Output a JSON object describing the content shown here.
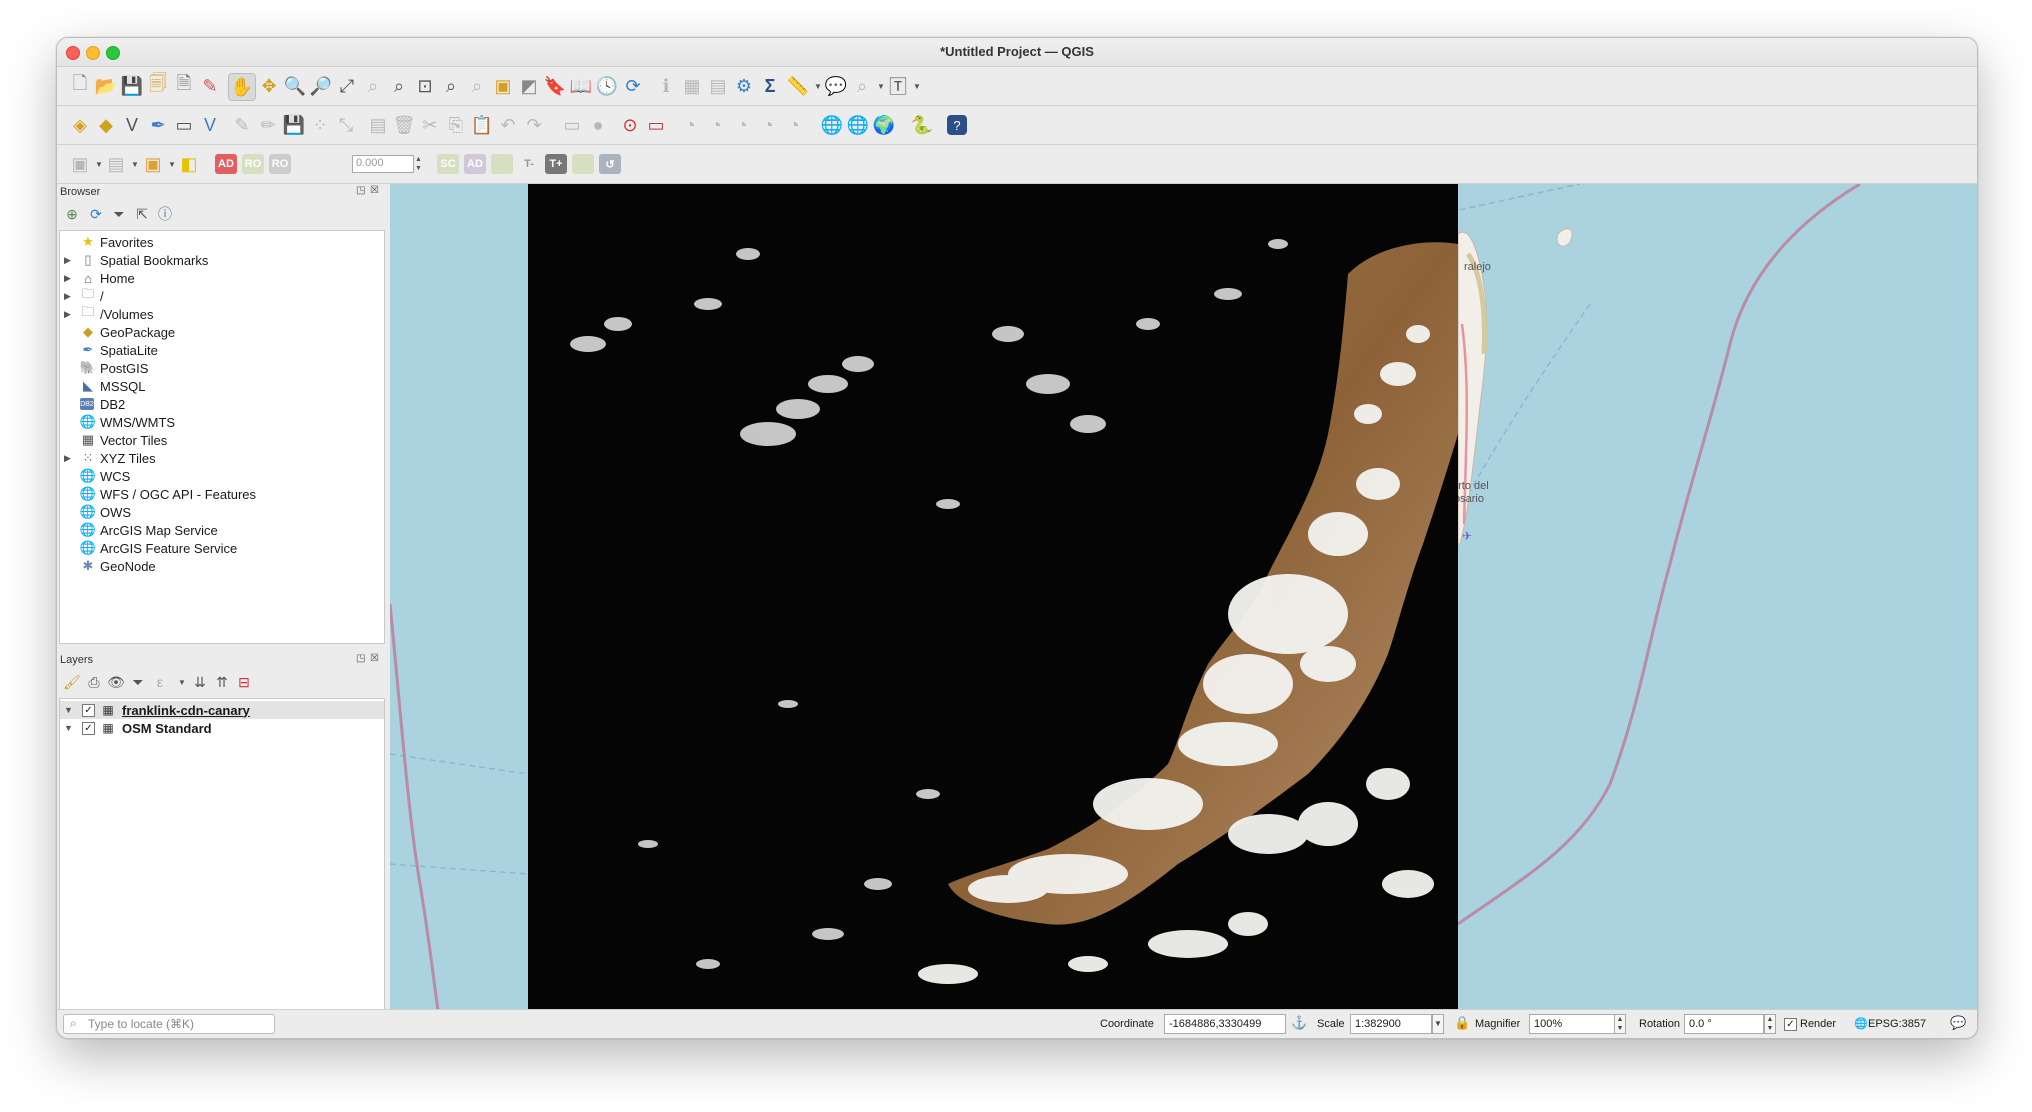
{
  "window": {
    "title": "*Untitled Project — QGIS"
  },
  "toolbar": {
    "snap_tolerance_value": "0.000",
    "advanced_digitizing_labels": [
      "AD",
      "RO",
      "RO",
      "SC",
      "AD",
      "T-",
      "T+"
    ]
  },
  "browser": {
    "title": "Browser",
    "items": [
      {
        "label": "Favorites",
        "icon": "star-icon",
        "expandable": false
      },
      {
        "label": "Spatial Bookmarks",
        "icon": "bookmark-icon",
        "expandable": true
      },
      {
        "label": "Home",
        "icon": "home-icon",
        "expandable": true
      },
      {
        "label": "/",
        "icon": "folder-icon",
        "expandable": true
      },
      {
        "label": "/Volumes",
        "icon": "folder-icon",
        "expandable": true
      },
      {
        "label": "GeoPackage",
        "icon": "geopackage-icon",
        "expandable": false
      },
      {
        "label": "SpatiaLite",
        "icon": "spatialite-icon",
        "expandable": false
      },
      {
        "label": "PostGIS",
        "icon": "postgis-icon",
        "expandable": false
      },
      {
        "label": "MSSQL",
        "icon": "mssql-icon",
        "expandable": false
      },
      {
        "label": "DB2",
        "icon": "db2-icon",
        "expandable": false
      },
      {
        "label": "WMS/WMTS",
        "icon": "globe-icon",
        "expandable": false
      },
      {
        "label": "Vector Tiles",
        "icon": "grid-icon",
        "expandable": false
      },
      {
        "label": "XYZ Tiles",
        "icon": "grid-icon",
        "expandable": true
      },
      {
        "label": "WCS",
        "icon": "globe-icon",
        "expandable": false
      },
      {
        "label": "WFS / OGC API - Features",
        "icon": "globe-icon",
        "expandable": false
      },
      {
        "label": "OWS",
        "icon": "globe-icon",
        "expandable": false
      },
      {
        "label": "ArcGIS Map Service",
        "icon": "globe-icon",
        "expandable": false
      },
      {
        "label": "ArcGIS Feature Service",
        "icon": "globe-icon",
        "expandable": false
      },
      {
        "label": "GeoNode",
        "icon": "geonode-icon",
        "expandable": false
      }
    ]
  },
  "layers": {
    "title": "Layers",
    "items": [
      {
        "label": "franklink-cdn-canary",
        "checked": true,
        "selected": true
      },
      {
        "label": "OSM Standard",
        "checked": true,
        "selected": false
      }
    ]
  },
  "map": {
    "labels": [
      "ralejo",
      "erto del",
      "osario"
    ],
    "colors": {
      "sea": "#aad3df",
      "raster_background": "#050505"
    }
  },
  "statusbar": {
    "locator_placeholder": "Type to locate (⌘K)",
    "coordinate_label": "Coordinate",
    "coordinate_value": "-1684886,3330499",
    "scale_label": "Scale",
    "scale_value": "1:382900",
    "magnifier_label": "Magnifier",
    "magnifier_value": "100%",
    "rotation_label": "Rotation",
    "rotation_value": "0.0 °",
    "render_label": "Render",
    "render_checked": true,
    "crs": "EPSG:3857"
  }
}
